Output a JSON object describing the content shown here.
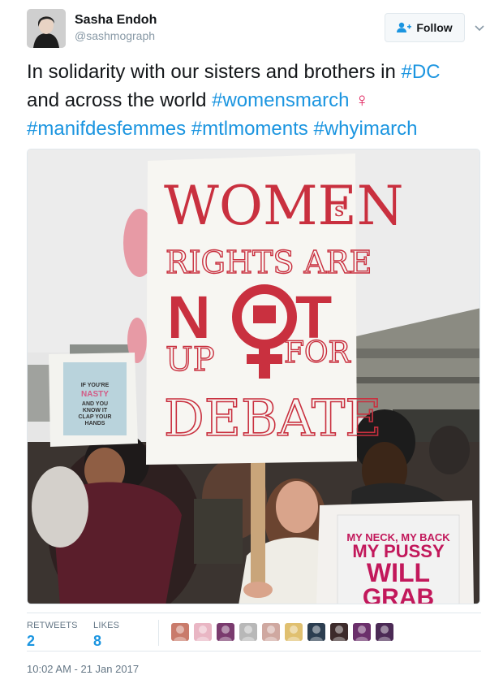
{
  "author": {
    "display_name": "Sasha Endoh",
    "username": "@sashmograph"
  },
  "follow_label": "Follow",
  "tweet": {
    "line1_text": "In solidarity with our sisters and brothers in ",
    "line1_hashtag": "#DC",
    "line2_text": "and across the world ",
    "line2_hashtag": "#womensmarch",
    "line2_symbol": "♀",
    "line3_hashtags": [
      "#manifdesfemmes",
      "#mtlmoments",
      "#whyimarch"
    ]
  },
  "photo": {
    "main_sign": [
      "WOMEN",
      "s",
      "RIGHTS ARE",
      "N",
      "T",
      "UP",
      "FOR",
      "DEBATE"
    ],
    "left_sign": [
      "IF YOU'RE",
      "NASTY",
      "AND YOU",
      "KNOW IT",
      "CLAP YOUR",
      "HANDS"
    ],
    "right_sign": [
      "MY NECK, MY BACK",
      "MY PUSSY",
      "WILL",
      "GRAB"
    ]
  },
  "stats": {
    "retweets_label": "RETWEETS",
    "retweets_count": "2",
    "likes_label": "LIKES",
    "likes_count": "8"
  },
  "likers": [
    {
      "color": "#c97b6b"
    },
    {
      "color": "#e9b6c4"
    },
    {
      "color": "#7a3b6e"
    },
    {
      "color": "#b8b8b8"
    },
    {
      "color": "#cfa8a0"
    },
    {
      "color": "#e0c070"
    },
    {
      "color": "#2c3e50"
    },
    {
      "color": "#3d2b2b"
    },
    {
      "color": "#6b2f6b"
    },
    {
      "color": "#4b2a55"
    }
  ],
  "timestamp": "10:02 AM - 21 Jan 2017",
  "colors": {
    "link": "#1b95e0",
    "venus": "#e0245e",
    "sign_red": "#c9303f"
  }
}
